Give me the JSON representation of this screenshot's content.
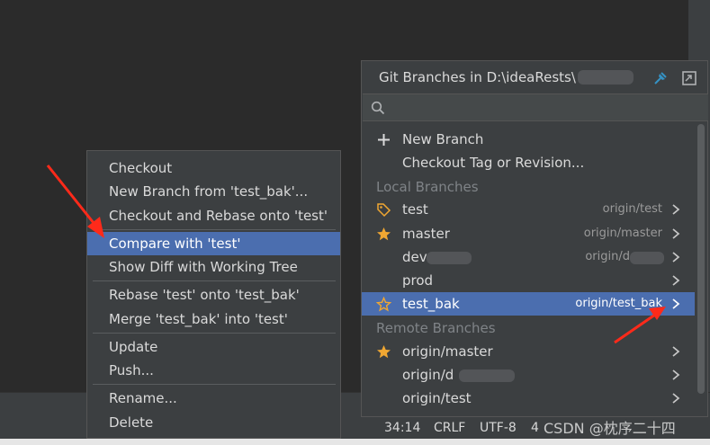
{
  "status_bar": {
    "position": "34:14",
    "line_sep": "CRLF",
    "encoding": "UTF-8",
    "indent": "4"
  },
  "watermark": "CSDN @枕序二十四",
  "context_menu": {
    "items": [
      "Checkout",
      "New Branch from 'test_bak'...",
      "Checkout and Rebase onto 'test'",
      "Compare with 'test'",
      "Show Diff with Working Tree",
      "Rebase 'test' onto 'test_bak'",
      "Merge 'test_bak' into 'test'",
      "Update",
      "Push...",
      "Rename...",
      "Delete"
    ]
  },
  "branches_popup": {
    "title": "Git Branches in D:\\ideaRests\\",
    "actions": {
      "new_branch": "New Branch",
      "checkout_tag": "Checkout Tag or Revision..."
    },
    "local_header": "Local Branches",
    "local": [
      {
        "name": "test",
        "tracking": "origin/test"
      },
      {
        "name": "master",
        "tracking": "origin/master"
      },
      {
        "name": "dev",
        "tracking": "origin/d"
      },
      {
        "name": "prod",
        "tracking": ""
      },
      {
        "name": "test_bak",
        "tracking": "origin/test_bak"
      }
    ],
    "remote_header": "Remote Branches",
    "remote": [
      {
        "name": "origin/master"
      },
      {
        "name": "origin/d"
      },
      {
        "name": "origin/test"
      }
    ]
  },
  "colors": {
    "selection": "#4b6eaf",
    "star": "#f0a732",
    "arrow": "#ff2a1a"
  }
}
